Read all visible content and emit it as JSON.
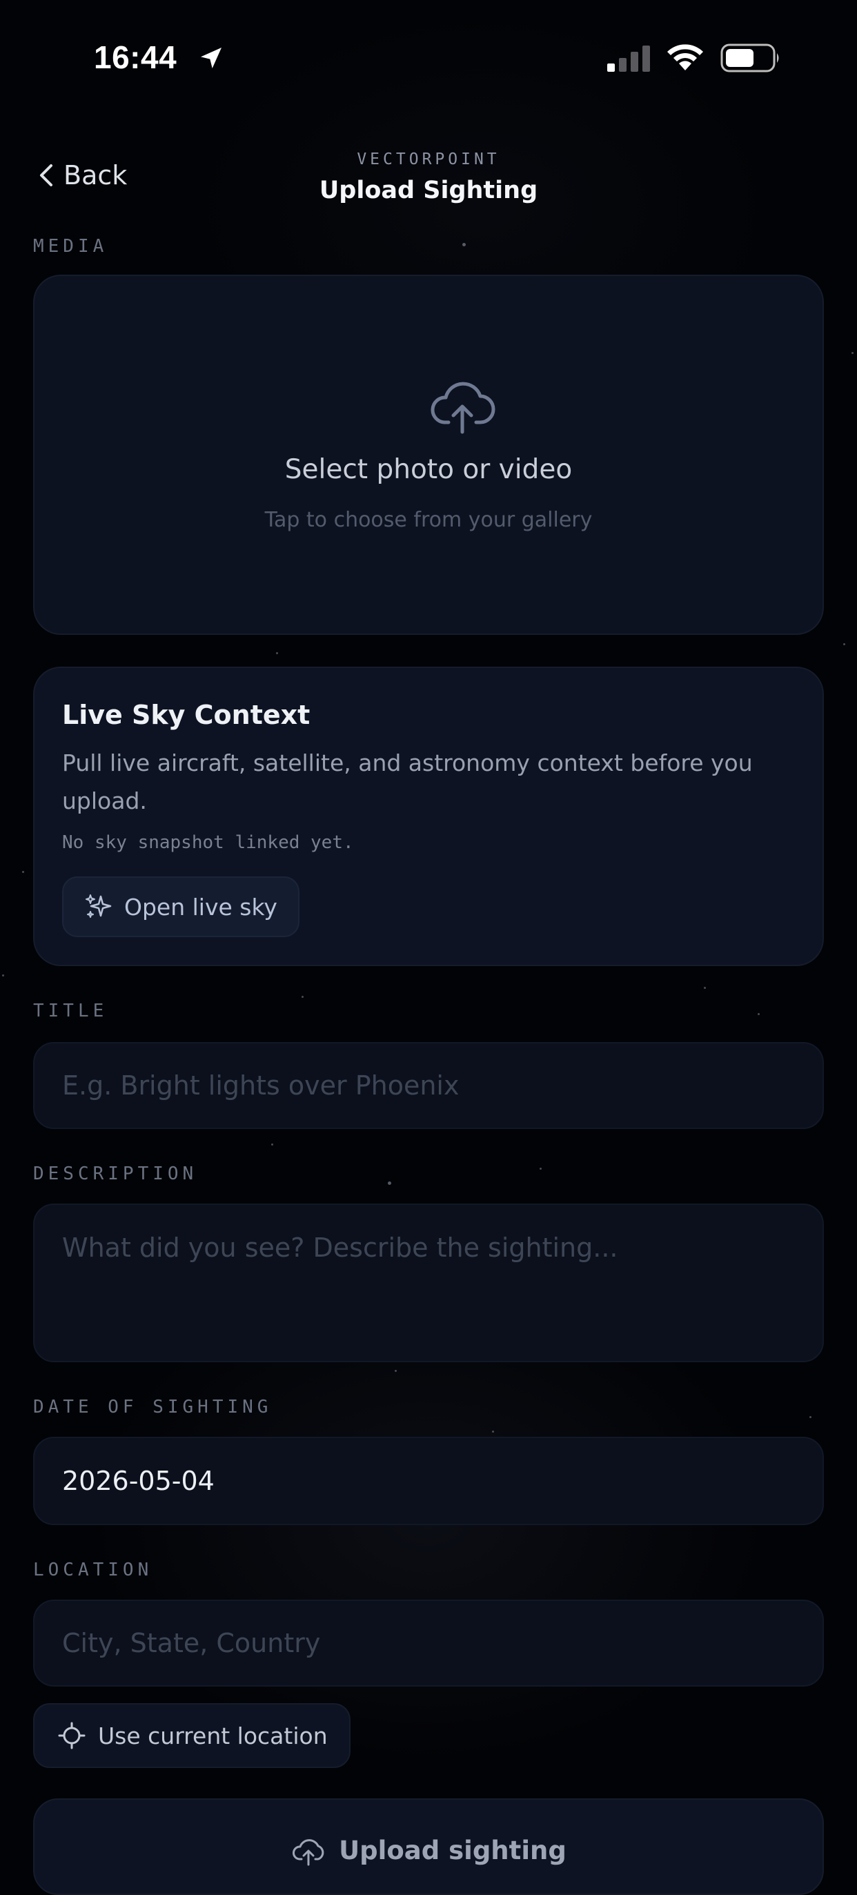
{
  "status": {
    "time": "16:44"
  },
  "nav": {
    "back_label": "Back",
    "eyebrow": "VECTORPOINT",
    "title": "Upload Sighting"
  },
  "media": {
    "label": "MEDIA",
    "title": "Select photo or video",
    "subtitle": "Tap to choose from your gallery",
    "icon": "cloud-upload-icon"
  },
  "sky": {
    "title": "Live Sky Context",
    "description": "Pull live aircraft, satellite, and astronomy context before you upload.",
    "note": "No sky snapshot linked yet.",
    "button_label": "Open live sky",
    "button_icon": "sparkles-icon"
  },
  "form": {
    "title_label": "TITLE",
    "title_placeholder": "E.g. Bright lights over Phoenix",
    "description_label": "DESCRIPTION",
    "description_placeholder": "What did you see? Describe the sighting...",
    "date_label": "DATE OF SIGHTING",
    "date_value": "2026-05-04",
    "location_label": "LOCATION",
    "location_placeholder": "City, State, Country",
    "use_location_label": "Use current location"
  },
  "submit": {
    "label": "Upload sighting"
  },
  "colors": {
    "background": "#020306",
    "card": "#0c1220",
    "accent": "#b9c3d9"
  }
}
